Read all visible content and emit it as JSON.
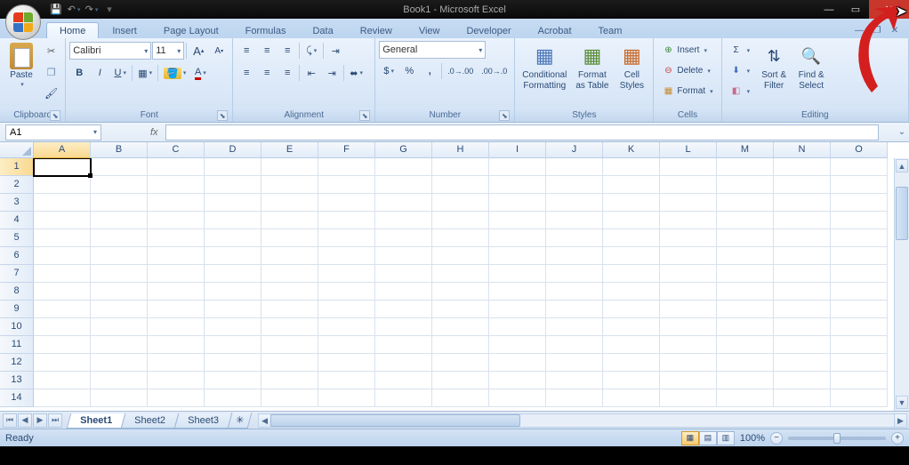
{
  "title": "Book1 - Microsoft Excel",
  "tabs": [
    "Home",
    "Insert",
    "Page Layout",
    "Formulas",
    "Data",
    "Review",
    "View",
    "Developer",
    "Acrobat",
    "Team"
  ],
  "activeTab": "Home",
  "groups": {
    "clipboard": "Clipboard",
    "font": "Font",
    "alignment": "Alignment",
    "number": "Number",
    "styles": "Styles",
    "cells": "Cells",
    "editing": "Editing"
  },
  "clipboard": {
    "paste": "Paste"
  },
  "font": {
    "name": "Calibri",
    "size": "11"
  },
  "number": {
    "format": "General"
  },
  "styles": {
    "conditional": "Conditional\nFormatting",
    "table": "Format\nas Table",
    "cell": "Cell\nStyles"
  },
  "cells": {
    "insert": "Insert",
    "delete": "Delete",
    "format": "Format"
  },
  "editing": {
    "sort": "Sort &\nFilter",
    "find": "Find &\nSelect"
  },
  "nameBox": "A1",
  "fx": "fx",
  "columns": [
    "A",
    "B",
    "C",
    "D",
    "E",
    "F",
    "G",
    "H",
    "I",
    "J",
    "K",
    "L",
    "M",
    "N",
    "O"
  ],
  "rowCount": 14,
  "activeCell": {
    "row": 1,
    "col": "A"
  },
  "sheets": [
    "Sheet1",
    "Sheet2",
    "Sheet3"
  ],
  "activeSheet": "Sheet1",
  "status": "Ready",
  "zoom": "100%"
}
